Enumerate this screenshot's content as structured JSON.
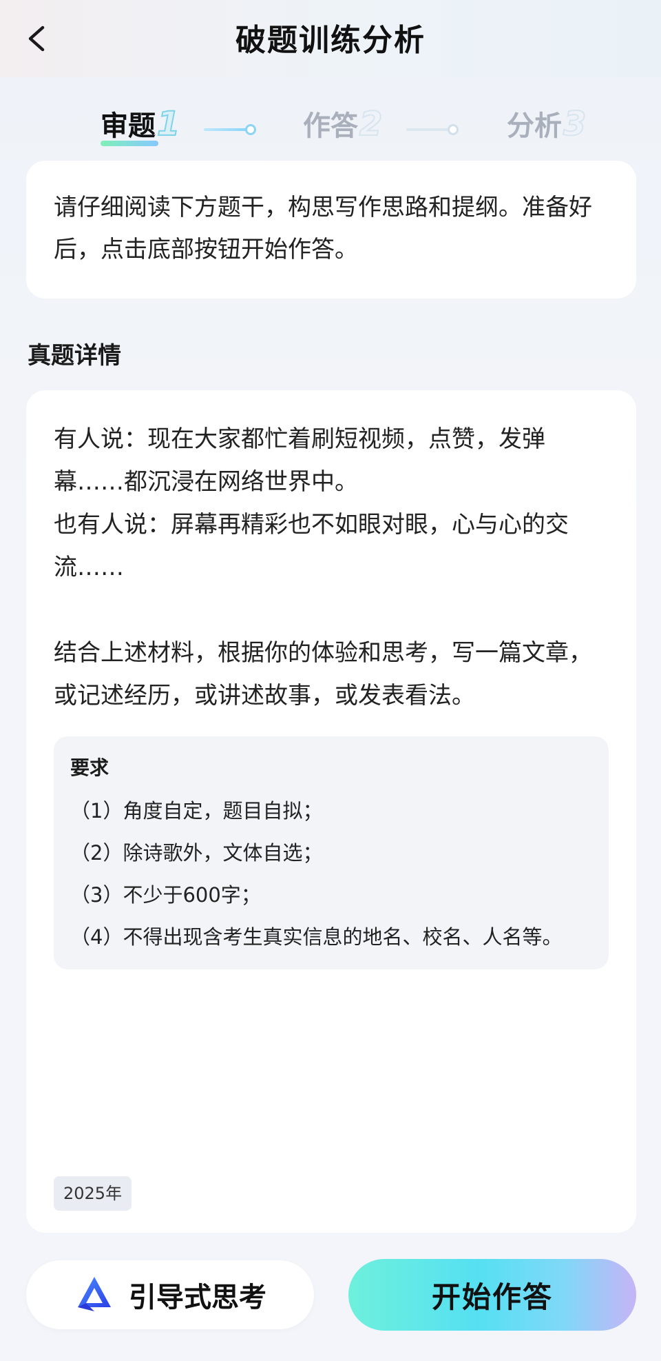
{
  "header": {
    "title": "破题训练分析",
    "back_icon": "chevron-left-icon"
  },
  "steps": [
    {
      "label": "审题",
      "num": "1",
      "state": "active"
    },
    {
      "label": "作答",
      "num": "2",
      "state": "inactive"
    },
    {
      "label": "分析",
      "num": "3",
      "state": "inactive"
    }
  ],
  "instruction": {
    "text": "请仔细阅读下方题干，构思写作思路和提纲。准备好后，点击底部按钮开始作答。"
  },
  "detail": {
    "section_title": "真题详情",
    "material_lines": [
      "有人说：现在大家都忙着刷短视频，点赞，发弹幕……都沉浸在网络世界中。",
      "也有人说：屏幕再精彩也不如眼对眼，心与心的交流……"
    ],
    "prompt": "结合上述材料，根据你的体验和思考，写一篇文章，或记述经历，或讲述故事，或发表看法。",
    "requirements": {
      "title": "要求",
      "items": [
        "（1）角度自定，题目自拟；",
        "（2）除诗歌外，文体自选；",
        "（3）不少于600字；",
        "（4）不得出现含考生真实信息的地名、校名、人名等。"
      ]
    },
    "year_tag": "2025年"
  },
  "buttons": {
    "guide_label": "引导式思考",
    "guide_icon": "guide-logo-icon",
    "start_label": "开始作答"
  },
  "colors": {
    "accent_gradient_start": "#6ef0dc",
    "accent_gradient_end": "#c6b4f6",
    "guide_icon_blue": "#3a5cf5"
  }
}
